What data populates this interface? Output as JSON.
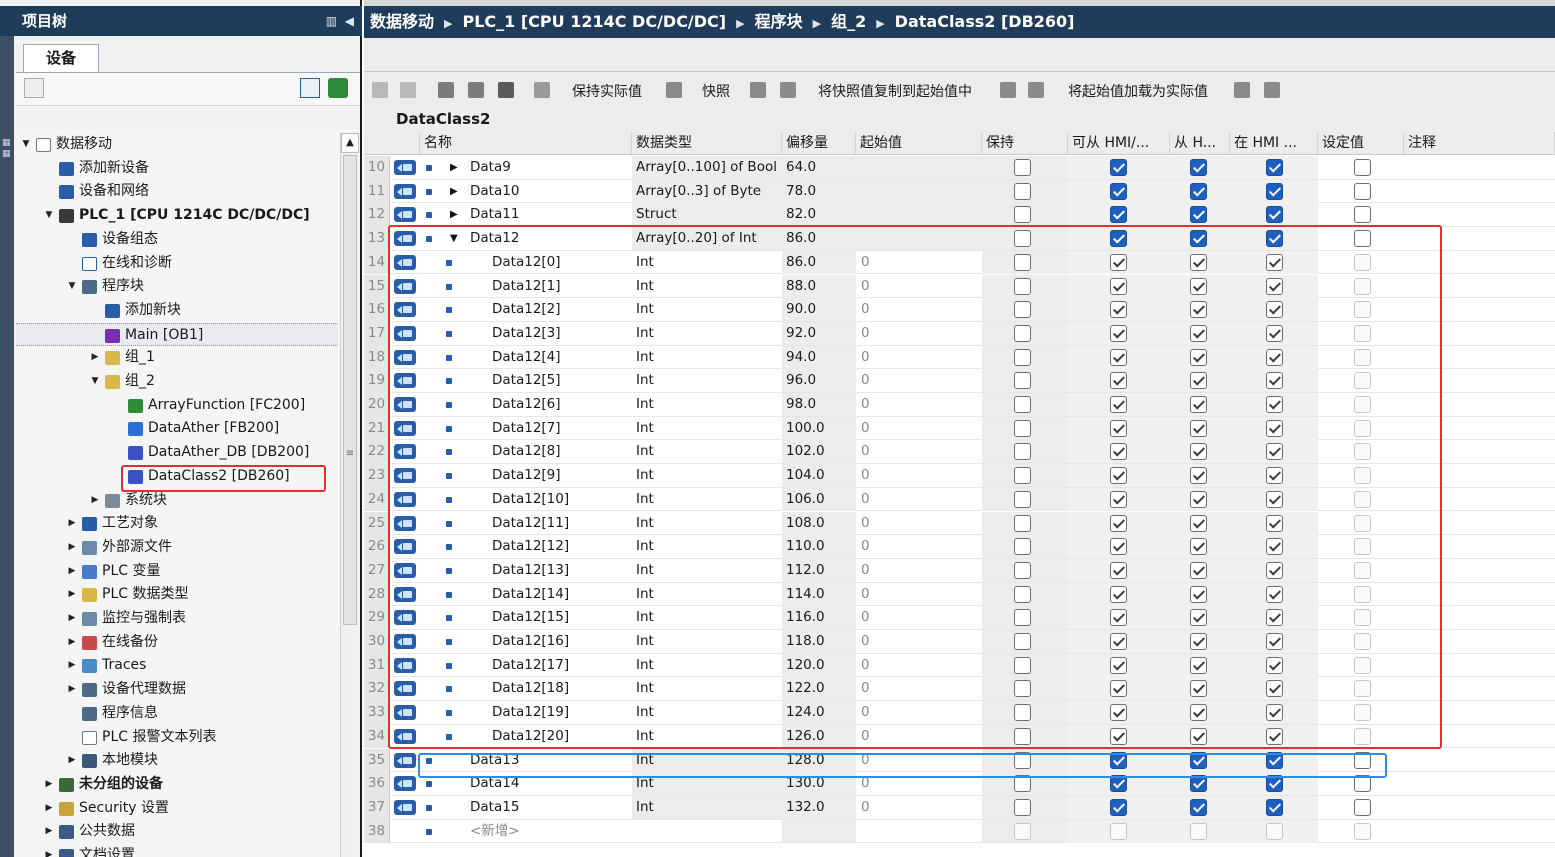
{
  "left_panel": {
    "title": "项目树",
    "device_tab": "设备",
    "tree": [
      {
        "label": "数据移动",
        "depth": 0,
        "arrow": "▼",
        "icon": "project-icon"
      },
      {
        "label": "添加新设备",
        "depth": 1,
        "arrow": "",
        "icon": "add-device-icon"
      },
      {
        "label": "设备和网络",
        "depth": 1,
        "arrow": "",
        "icon": "network-icon"
      },
      {
        "label": "PLC_1 [CPU 1214C DC/DC/DC]",
        "depth": 1,
        "arrow": "▼",
        "icon": "plc-icon",
        "bold": true
      },
      {
        "label": "设备组态",
        "depth": 2,
        "arrow": "",
        "icon": "device-config-icon"
      },
      {
        "label": "在线和诊断",
        "depth": 2,
        "arrow": "",
        "icon": "diagnostics-icon"
      },
      {
        "label": "程序块",
        "depth": 2,
        "arrow": "▼",
        "icon": "program-blocks-icon"
      },
      {
        "label": "添加新块",
        "depth": 3,
        "arrow": "",
        "icon": "add-block-icon"
      },
      {
        "label": "Main [OB1]",
        "depth": 3,
        "arrow": "",
        "icon": "ob-icon",
        "selected": true
      },
      {
        "label": "组_1",
        "depth": 3,
        "arrow": "▶",
        "icon": "folder-icon"
      },
      {
        "label": "组_2",
        "depth": 3,
        "arrow": "▼",
        "icon": "folder-icon"
      },
      {
        "label": "ArrayFunction [FC200]",
        "depth": 4,
        "arrow": "",
        "icon": "fc-icon"
      },
      {
        "label": "DataAther [FB200]",
        "depth": 4,
        "arrow": "",
        "icon": "fb-icon"
      },
      {
        "label": "DataAther_DB [DB200]",
        "depth": 4,
        "arrow": "",
        "icon": "db-icon"
      },
      {
        "label": "DataClass2 [DB260]",
        "depth": 4,
        "arrow": "",
        "icon": "db-icon"
      },
      {
        "label": "系统块",
        "depth": 3,
        "arrow": "▶",
        "icon": "system-blocks-icon"
      },
      {
        "label": "工艺对象",
        "depth": 2,
        "arrow": "▶",
        "icon": "technology-objects-icon"
      },
      {
        "label": "外部源文件",
        "depth": 2,
        "arrow": "▶",
        "icon": "external-source-icon"
      },
      {
        "label": "PLC 变量",
        "depth": 2,
        "arrow": "▶",
        "icon": "plc-tags-icon"
      },
      {
        "label": "PLC 数据类型",
        "depth": 2,
        "arrow": "▶",
        "icon": "plc-datatypes-icon"
      },
      {
        "label": "监控与强制表",
        "depth": 2,
        "arrow": "▶",
        "icon": "watch-table-icon"
      },
      {
        "label": "在线备份",
        "depth": 2,
        "arrow": "▶",
        "icon": "online-backup-icon"
      },
      {
        "label": "Traces",
        "depth": 2,
        "arrow": "▶",
        "icon": "traces-icon"
      },
      {
        "label": "设备代理数据",
        "depth": 2,
        "arrow": "▶",
        "icon": "device-proxy-icon"
      },
      {
        "label": "程序信息",
        "depth": 2,
        "arrow": "",
        "icon": "program-info-icon"
      },
      {
        "label": "PLC 报警文本列表",
        "depth": 2,
        "arrow": "",
        "icon": "alarm-text-icon"
      },
      {
        "label": "本地模块",
        "depth": 2,
        "arrow": "▶",
        "icon": "local-modules-icon"
      },
      {
        "label": "未分组的设备",
        "depth": 1,
        "arrow": "▶",
        "icon": "ungrouped-devices-icon",
        "bold": true
      },
      {
        "label": "Security 设置",
        "depth": 1,
        "arrow": "▶",
        "icon": "security-icon"
      },
      {
        "label": "公共数据",
        "depth": 1,
        "arrow": "▶",
        "icon": "common-data-icon"
      },
      {
        "label": "文档设置",
        "depth": 1,
        "arrow": "▶",
        "icon": "doc-settings-icon"
      }
    ]
  },
  "breadcrumb": [
    "数据移动",
    "PLC_1 [CPU 1214C DC/DC/DC]",
    "程序块",
    "组_2",
    "DataClass2 [DB260]"
  ],
  "toolbar": {
    "keep_actual": "保持实际值",
    "snapshot": "快照",
    "copy_snapshot": "将快照值复制到起始值中",
    "load_start": "将起始值加载为实际值"
  },
  "db_title": "DataClass2",
  "columns": [
    "名称",
    "数据类型",
    "偏移量",
    "起始值",
    "保持",
    "可从 HMI/...",
    "从 H...",
    "在 HMI ...",
    "设定值",
    "注释"
  ],
  "rows": [
    {
      "n": "10",
      "name": "Data9",
      "type": "Array[0..100] of Bool",
      "offset": "64.0",
      "start": "",
      "indent": 0,
      "exp": "▶",
      "chk": "blue"
    },
    {
      "n": "11",
      "name": "Data10",
      "type": "Array[0..3] of Byte",
      "offset": "78.0",
      "start": "",
      "indent": 0,
      "exp": "▶",
      "chk": "blue"
    },
    {
      "n": "12",
      "name": "Data11",
      "type": "Struct",
      "offset": "82.0",
      "start": "",
      "indent": 0,
      "exp": "▶",
      "chk": "blue"
    },
    {
      "n": "13",
      "name": "Data12",
      "type": "Array[0..20] of Int",
      "offset": "86.0",
      "start": "",
      "indent": 0,
      "exp": "▼",
      "chk": "blue"
    },
    {
      "n": "14",
      "name": "Data12[0]",
      "type": "Int",
      "offset": "86.0",
      "start": "0",
      "indent": 1,
      "exp": "",
      "chk": "gray"
    },
    {
      "n": "15",
      "name": "Data12[1]",
      "type": "Int",
      "offset": "88.0",
      "start": "0",
      "indent": 1,
      "exp": "",
      "chk": "gray"
    },
    {
      "n": "16",
      "name": "Data12[2]",
      "type": "Int",
      "offset": "90.0",
      "start": "0",
      "indent": 1,
      "exp": "",
      "chk": "gray"
    },
    {
      "n": "17",
      "name": "Data12[3]",
      "type": "Int",
      "offset": "92.0",
      "start": "0",
      "indent": 1,
      "exp": "",
      "chk": "gray"
    },
    {
      "n": "18",
      "name": "Data12[4]",
      "type": "Int",
      "offset": "94.0",
      "start": "0",
      "indent": 1,
      "exp": "",
      "chk": "gray"
    },
    {
      "n": "19",
      "name": "Data12[5]",
      "type": "Int",
      "offset": "96.0",
      "start": "0",
      "indent": 1,
      "exp": "",
      "chk": "gray"
    },
    {
      "n": "20",
      "name": "Data12[6]",
      "type": "Int",
      "offset": "98.0",
      "start": "0",
      "indent": 1,
      "exp": "",
      "chk": "gray"
    },
    {
      "n": "21",
      "name": "Data12[7]",
      "type": "Int",
      "offset": "100.0",
      "start": "0",
      "indent": 1,
      "exp": "",
      "chk": "gray"
    },
    {
      "n": "22",
      "name": "Data12[8]",
      "type": "Int",
      "offset": "102.0",
      "start": "0",
      "indent": 1,
      "exp": "",
      "chk": "gray"
    },
    {
      "n": "23",
      "name": "Data12[9]",
      "type": "Int",
      "offset": "104.0",
      "start": "0",
      "indent": 1,
      "exp": "",
      "chk": "gray"
    },
    {
      "n": "24",
      "name": "Data12[10]",
      "type": "Int",
      "offset": "106.0",
      "start": "0",
      "indent": 1,
      "exp": "",
      "chk": "gray"
    },
    {
      "n": "25",
      "name": "Data12[11]",
      "type": "Int",
      "offset": "108.0",
      "start": "0",
      "indent": 1,
      "exp": "",
      "chk": "gray"
    },
    {
      "n": "26",
      "name": "Data12[12]",
      "type": "Int",
      "offset": "110.0",
      "start": "0",
      "indent": 1,
      "exp": "",
      "chk": "gray"
    },
    {
      "n": "27",
      "name": "Data12[13]",
      "type": "Int",
      "offset": "112.0",
      "start": "0",
      "indent": 1,
      "exp": "",
      "chk": "gray"
    },
    {
      "n": "28",
      "name": "Data12[14]",
      "type": "Int",
      "offset": "114.0",
      "start": "0",
      "indent": 1,
      "exp": "",
      "chk": "gray"
    },
    {
      "n": "29",
      "name": "Data12[15]",
      "type": "Int",
      "offset": "116.0",
      "start": "0",
      "indent": 1,
      "exp": "",
      "chk": "gray"
    },
    {
      "n": "30",
      "name": "Data12[16]",
      "type": "Int",
      "offset": "118.0",
      "start": "0",
      "indent": 1,
      "exp": "",
      "chk": "gray"
    },
    {
      "n": "31",
      "name": "Data12[17]",
      "type": "Int",
      "offset": "120.0",
      "start": "0",
      "indent": 1,
      "exp": "",
      "chk": "gray"
    },
    {
      "n": "32",
      "name": "Data12[18]",
      "type": "Int",
      "offset": "122.0",
      "start": "0",
      "indent": 1,
      "exp": "",
      "chk": "gray"
    },
    {
      "n": "33",
      "name": "Data12[19]",
      "type": "Int",
      "offset": "124.0",
      "start": "0",
      "indent": 1,
      "exp": "",
      "chk": "gray"
    },
    {
      "n": "34",
      "name": "Data12[20]",
      "type": "Int",
      "offset": "126.0",
      "start": "0",
      "indent": 1,
      "exp": "",
      "chk": "gray"
    },
    {
      "n": "35",
      "name": "Data13",
      "type": "Int",
      "offset": "128.0",
      "start": "0",
      "indent": 0,
      "exp": "",
      "chk": "blue"
    },
    {
      "n": "36",
      "name": "Data14",
      "type": "Int",
      "offset": "130.0",
      "start": "0",
      "indent": 0,
      "exp": "",
      "chk": "blue"
    },
    {
      "n": "37",
      "name": "Data15",
      "type": "Int",
      "offset": "132.0",
      "start": "0",
      "indent": 0,
      "exp": "",
      "chk": "blue"
    },
    {
      "n": "38",
      "name": "<新增>",
      "type": "",
      "offset": "",
      "start": "",
      "indent": 0,
      "exp": "",
      "chk": "none"
    }
  ],
  "colors": {
    "title_bar": "#1f3c5a",
    "highlight_red": "#e63030",
    "highlight_blue": "#2f8ce6",
    "checkbox_blue": "#1f5fbf"
  }
}
